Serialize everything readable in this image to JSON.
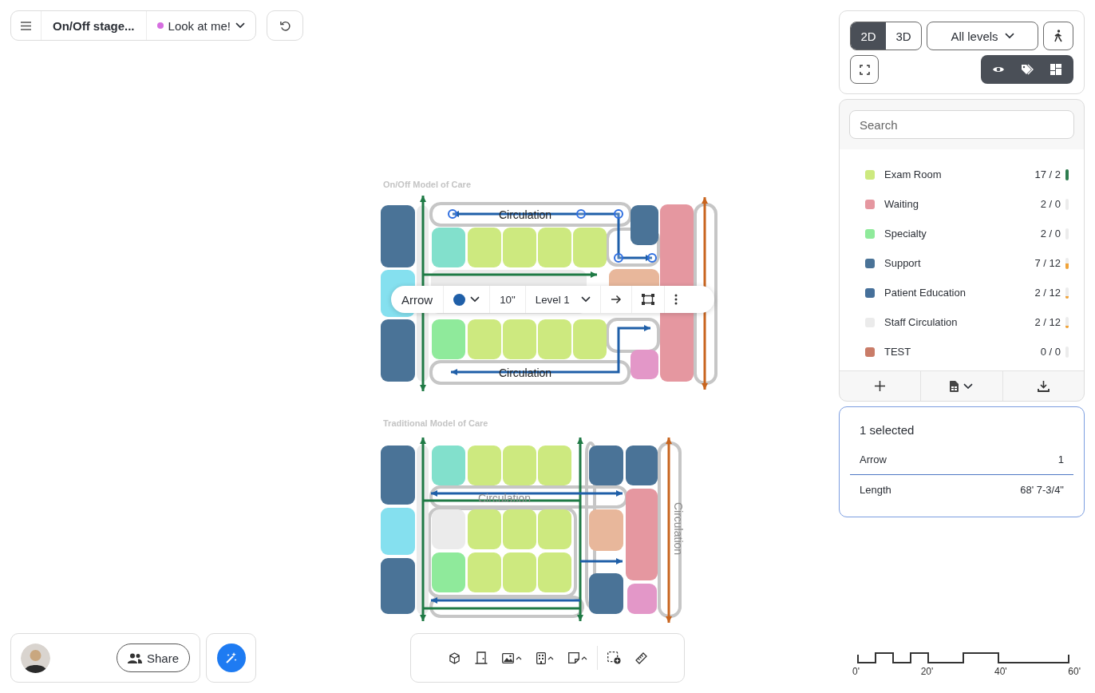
{
  "top_bar": {
    "title": "On/Off stage...",
    "status": {
      "label": "Look at me!",
      "color": "#d66ee0"
    }
  },
  "plans": [
    {
      "kind": "on-off",
      "title": "On/Off Model of Care",
      "labels": [
        "Circulation",
        "Circulation"
      ]
    },
    {
      "kind": "traditional",
      "title": "Traditional Model of Care",
      "labels": [
        "Circulation",
        "Circulation"
      ]
    }
  ],
  "selection_toolbar": {
    "type": "Arrow",
    "color": "#1f5fa8",
    "size": "10\"",
    "level": "Level 1"
  },
  "view_tabs": [
    {
      "label": "2D",
      "selected": true
    },
    {
      "label": "3D",
      "selected": false
    }
  ],
  "level_select": "All levels",
  "search": {
    "placeholder": "Search"
  },
  "categories": [
    {
      "name": "Exam Room",
      "count": "17 / 2",
      "color": "#cde97f",
      "level": 1
    },
    {
      "name": "Waiting",
      "count": "2 / 0",
      "color": "#e597a0",
      "level": 0
    },
    {
      "name": "Specialty",
      "count": "2 / 0",
      "color": "#8fea9b",
      "level": 0
    },
    {
      "name": "Support",
      "count": "7 / 12",
      "color": "#4a7397",
      "level": 0.45
    },
    {
      "name": "Patient Education",
      "count": "2 / 12",
      "color": "#46709a",
      "level": 0.15
    },
    {
      "name": "Staff Circulation",
      "count": "2 / 12",
      "color": "#ebebeb",
      "level": 0.15
    },
    {
      "name": "TEST",
      "count": "0 / 0",
      "color": "#c97c68",
      "level": 0
    }
  ],
  "selection": {
    "title": "1 selected",
    "rows": [
      {
        "label": "Arrow",
        "value": "1"
      },
      {
        "label": "Length",
        "value": "68' 7-3/4\""
      }
    ]
  },
  "share": "Share",
  "scale": [
    "0'",
    "20'",
    "40'",
    "60'"
  ]
}
